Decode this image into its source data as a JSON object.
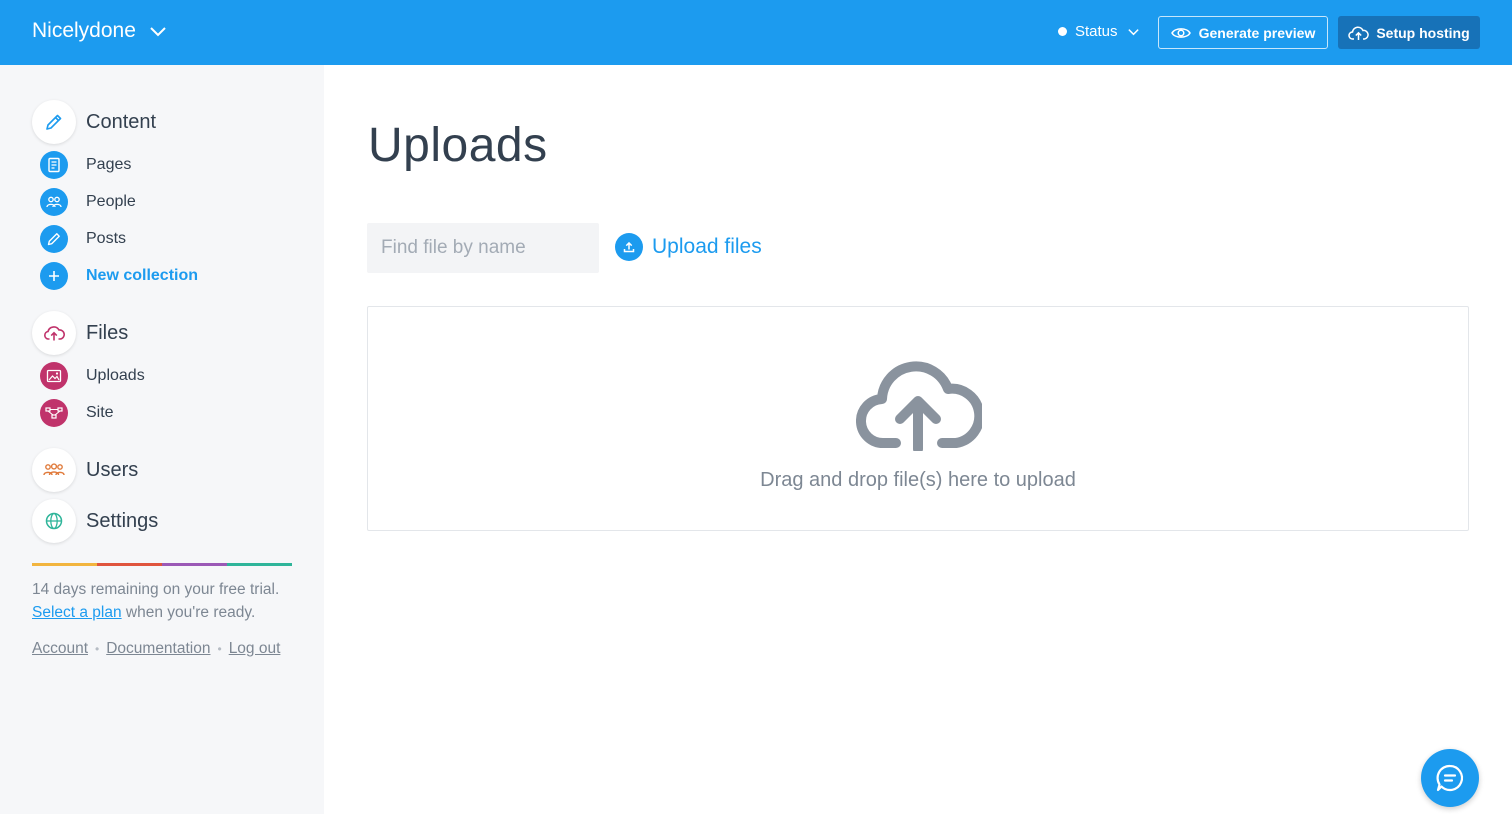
{
  "topbar": {
    "site_name": "Nicelydone",
    "status_label": "Status",
    "preview_label": "Generate preview",
    "hosting_label": "Setup hosting",
    "colors": {
      "bar": "#1c9bef",
      "hosting_button": "#1772b8"
    }
  },
  "sidebar": {
    "content": {
      "label": "Content",
      "items": [
        {
          "label": "Pages",
          "icon": "document-icon"
        },
        {
          "label": "People",
          "icon": "people-icon"
        },
        {
          "label": "Posts",
          "icon": "pencil-icon"
        },
        {
          "label": "New collection",
          "icon": "plus-icon"
        }
      ]
    },
    "files": {
      "label": "Files",
      "items": [
        {
          "label": "Uploads",
          "icon": "image-icon"
        },
        {
          "label": "Site",
          "icon": "sitemap-icon"
        }
      ]
    },
    "users": {
      "label": "Users"
    },
    "settings": {
      "label": "Settings"
    },
    "trial": {
      "text": "14 days remaining on your free trial.",
      "link": "Select a plan",
      "suffix": " when you're ready."
    },
    "links": {
      "account": "Account",
      "documentation": "Documentation",
      "logout": "Log out"
    },
    "rainbow_colors": [
      "#f2b53f",
      "#e0553e",
      "#9b59b6",
      "#2fb59a"
    ]
  },
  "main": {
    "title": "Uploads",
    "search_placeholder": "Find file by name",
    "upload_label": "Upload files",
    "dropzone_hint": "Drag and drop file(s) here to upload"
  }
}
